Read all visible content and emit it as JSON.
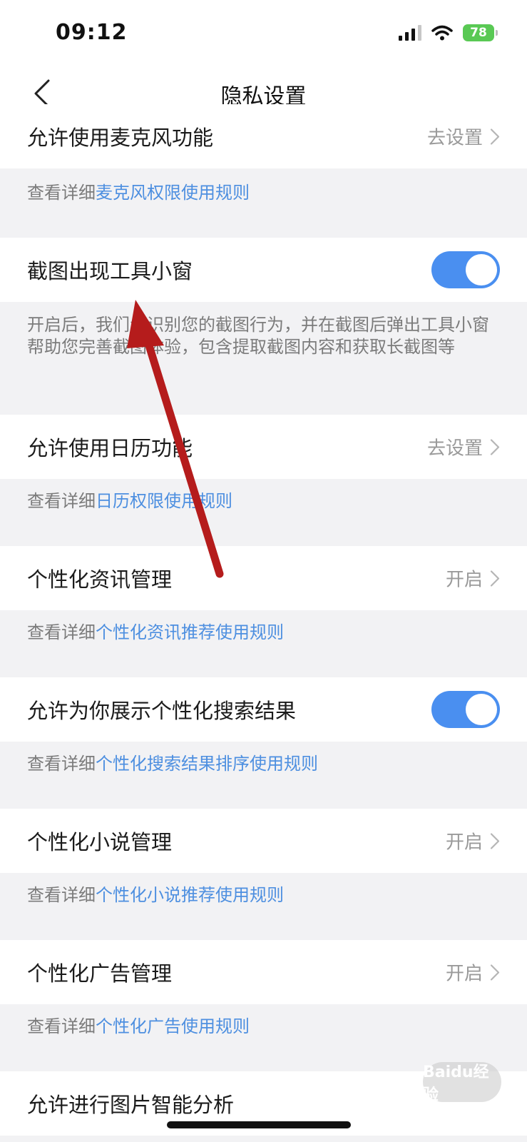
{
  "status_bar": {
    "time": "09:12",
    "battery": "78"
  },
  "nav": {
    "title": "隐私设置"
  },
  "rows": [
    {
      "label": "允许使用麦克风功能",
      "action": "去设置"
    },
    {
      "label": "截图出现工具小窗",
      "toggle": true
    },
    {
      "label": "允许使用日历功能",
      "action": "去设置"
    },
    {
      "label": "个性化资讯管理",
      "action": "开启"
    },
    {
      "label": "允许为你展示个性化搜索结果",
      "toggle": true
    },
    {
      "label": "个性化小说管理",
      "action": "开启"
    },
    {
      "label": "个性化广告管理",
      "action": "开启"
    },
    {
      "label": "允许进行图片智能分析"
    }
  ],
  "descriptions": [
    {
      "prefix": "查看详细",
      "link": "麦克风权限使用规则"
    },
    {
      "text": "开启后，我们会识别您的截图行为，并在截图后弹出工具小窗帮助您完善截图体验，包含提取截图内容和获取长截图等"
    },
    {
      "prefix": "查看详细",
      "link": "日历权限使用规则"
    },
    {
      "prefix": "查看详细",
      "link": "个性化资讯推荐使用规则"
    },
    {
      "prefix": "查看详细",
      "link": "个性化搜索结果排序使用规则"
    },
    {
      "prefix": "查看详细",
      "link": "个性化小说推荐使用规则"
    },
    {
      "prefix": "查看详细",
      "link": "个性化广告使用规则"
    }
  ],
  "watermark": "Baidu经验",
  "colors": {
    "accent": "#4a8ff0",
    "link": "#4d8fe0",
    "arrow": "#b51c1c",
    "battery": "#59c954"
  }
}
